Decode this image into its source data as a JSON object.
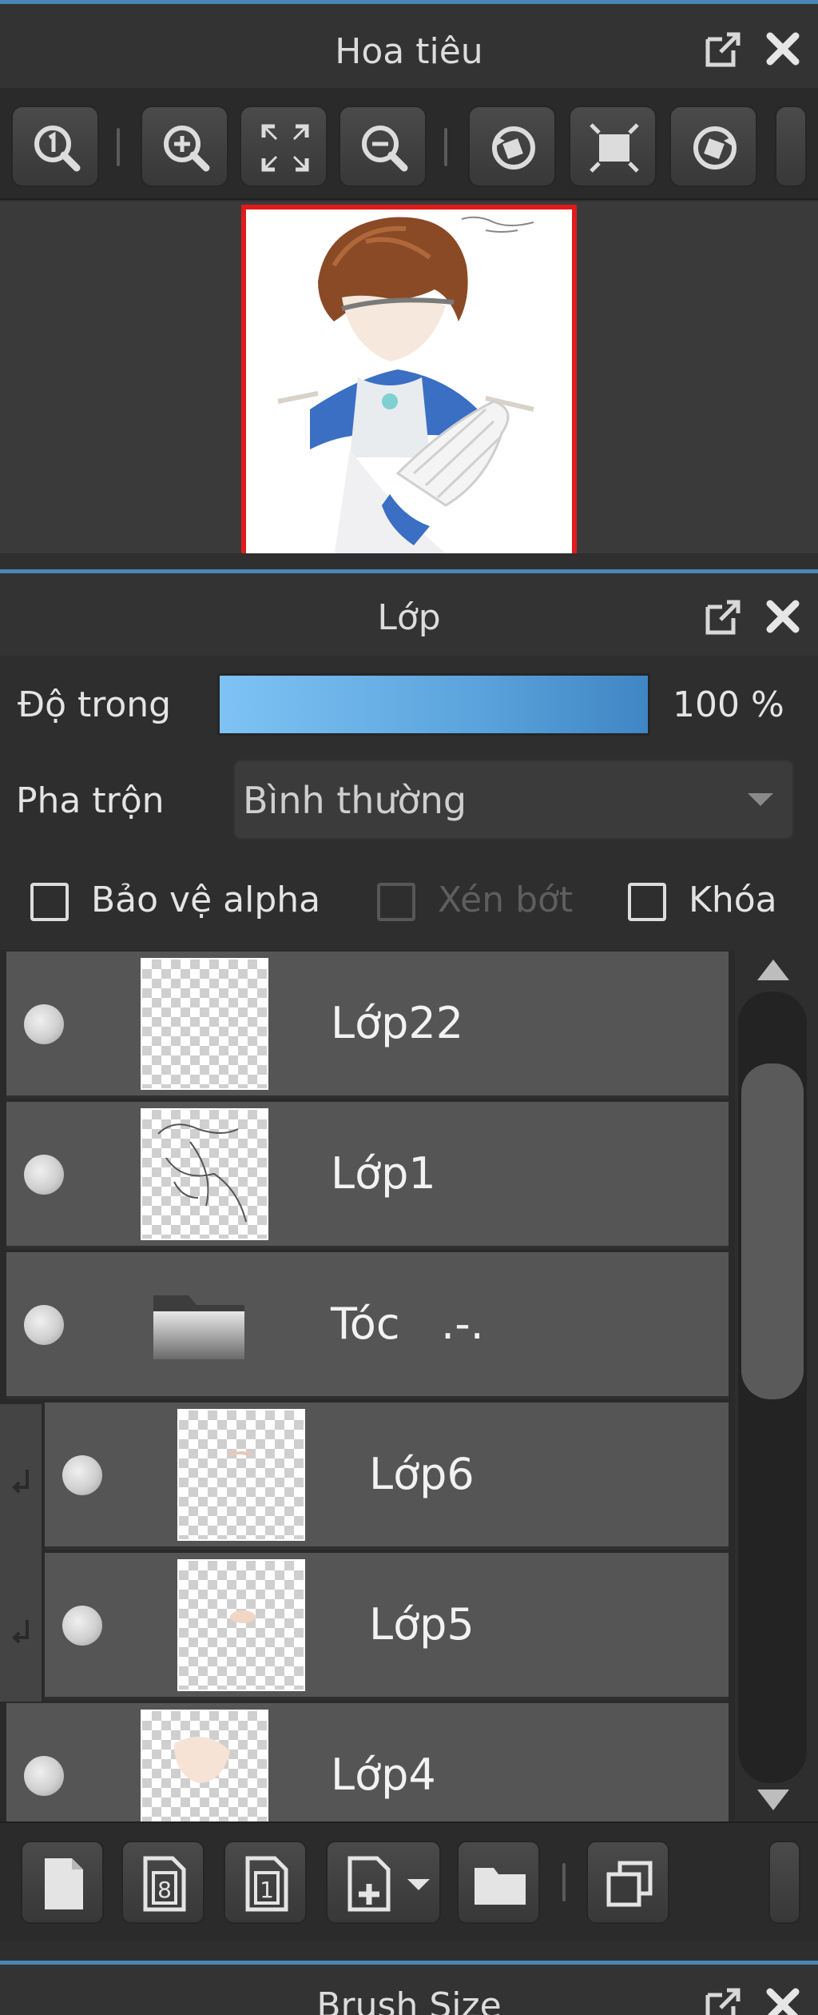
{
  "navigator": {
    "title": "Hoa tiêu",
    "toolbar": [
      "zoom-actual-icon",
      "zoom-in-icon",
      "fit-screen-icon",
      "zoom-out-icon",
      "rotate-left-icon",
      "fullscreen-icon",
      "rotate-right-icon"
    ]
  },
  "layers": {
    "title": "Lớp",
    "opacity": {
      "label": "Độ trong",
      "value_text": "100 %",
      "value": 1.0
    },
    "blend": {
      "label": "Pha trộn",
      "selected": "Bình thường"
    },
    "options": [
      {
        "label": "Bảo vệ alpha",
        "checked": false,
        "enabled": true
      },
      {
        "label": "Xén bớt",
        "checked": false,
        "enabled": false
      },
      {
        "label": "Khóa",
        "checked": false,
        "enabled": true
      }
    ],
    "list": [
      {
        "name": "Lớp22",
        "type": "layer",
        "clipped": false
      },
      {
        "name": "Lớp1",
        "type": "layer",
        "clipped": false
      },
      {
        "name": "Tóc   .-.",
        "type": "folder",
        "clipped": false
      },
      {
        "name": "Lớp6",
        "type": "layer",
        "clipped": true
      },
      {
        "name": "Lớp5",
        "type": "layer",
        "clipped": true
      },
      {
        "name": "Lớp4",
        "type": "layer",
        "clipped": false
      }
    ],
    "toolbar": [
      "new-layer-icon",
      "new-8bit-layer-icon",
      "new-1bit-layer-icon",
      "add-layer-menu-icon",
      "new-folder-icon",
      "duplicate-layer-icon"
    ]
  },
  "brush_size": {
    "title": "Brush Size"
  },
  "colors": {
    "accent": "#4a86b8",
    "opacity_fill": "#5aa3dc",
    "preview_border": "#e01a1a"
  }
}
